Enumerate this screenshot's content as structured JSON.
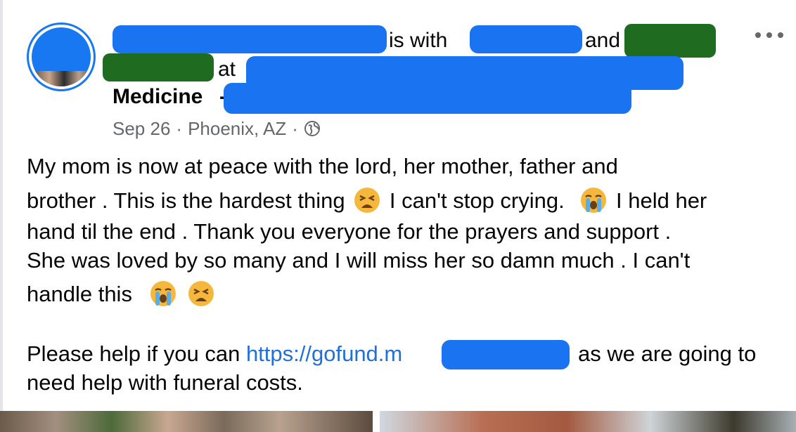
{
  "post": {
    "header_line1_with": "is with",
    "header_line1_and": "and",
    "header_line2_at": "at",
    "header_line3": "Medicine",
    "header_line3_dash": "-",
    "date": "Sep 26",
    "separator": "·",
    "location": "Phoenix, AZ",
    "audience_icon": "globe-icon",
    "more_icon": "more-options-icon"
  },
  "body": {
    "line1": "My mom is now at peace with the lord, her mother, father and",
    "line2a": "brother . This is the hardest thing",
    "line2b": "I can't stop crying.",
    "line2c": "I held her",
    "line3": "hand til the end . Thank you everyone for the prayers and support .",
    "line4": "She was loved by so many and I will miss her so damn much . I can't",
    "line5": "handle this",
    "line6a": "Please help if you can",
    "line6_link": "https://gofund.m",
    "line6b": "as we are going to",
    "line7": "need help with funeral costs."
  },
  "emoji": {
    "tired": "tired-face-emoji",
    "crying": "loudly-crying-face-emoji"
  },
  "colors": {
    "accent": "#1877f2",
    "link": "#216fdb",
    "secondary_text": "#65676b",
    "redaction_blue": "#1a73f0",
    "redaction_green": "#1f6b1f"
  }
}
